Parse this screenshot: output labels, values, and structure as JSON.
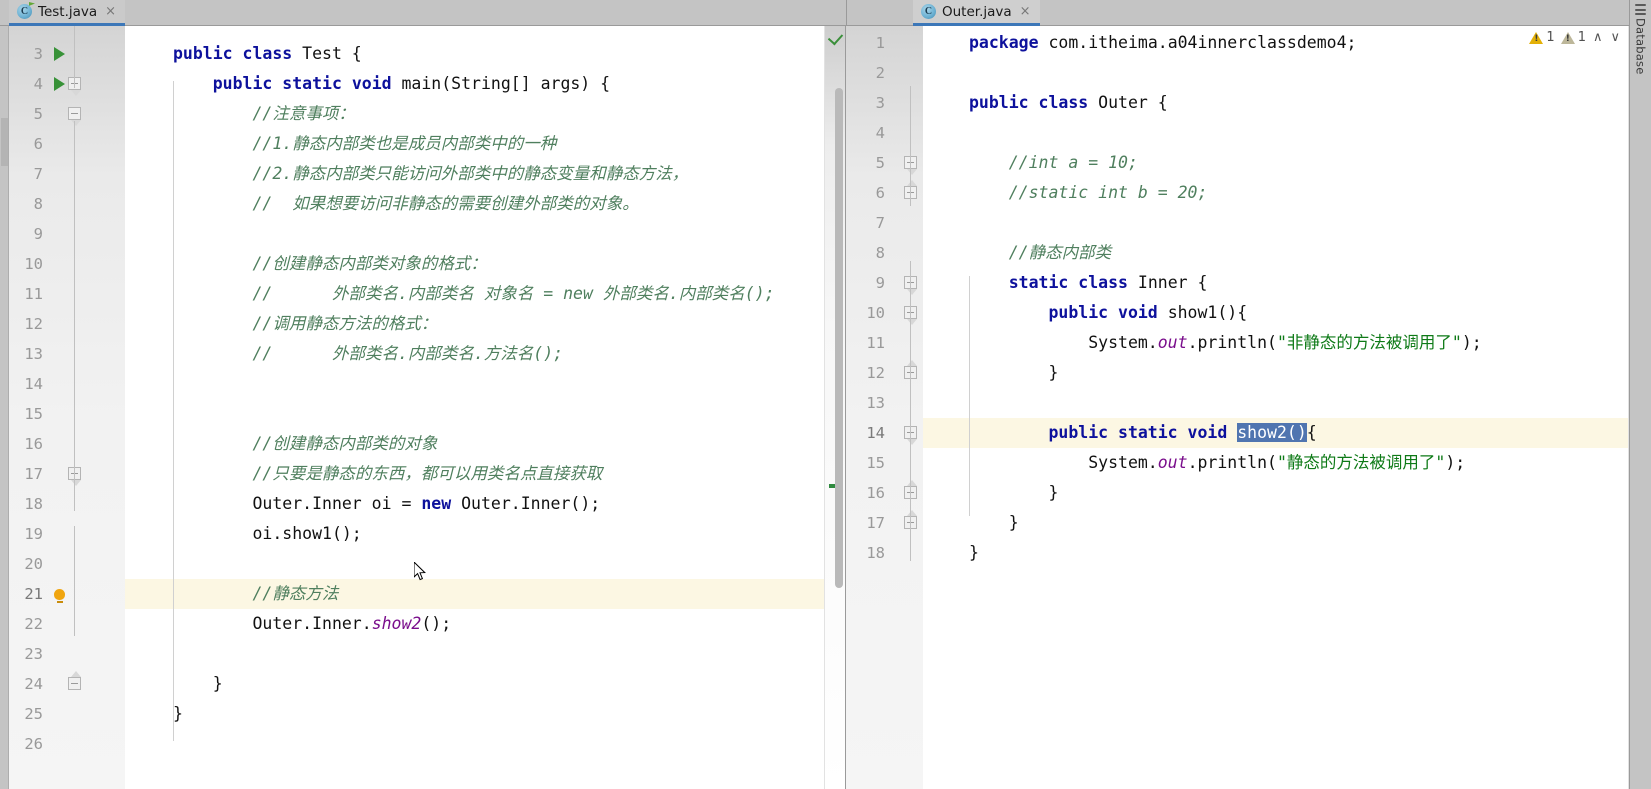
{
  "app": {
    "name": "IntelliJ IDEA Editor",
    "right_tool_label": "Database"
  },
  "tabs": {
    "left": {
      "label": "Test.java",
      "icon": "java-class-file-icon",
      "close": "×"
    },
    "right": {
      "label": "Outer.java",
      "icon": "java-class-file-icon",
      "close": "×"
    }
  },
  "inspection": {
    "warning_icon": "warning-triangle-icon",
    "warning_count": "1",
    "weak_icon": "weak-warning-triangle-icon",
    "weak_count": "1",
    "prev_icon": "chevron-up-icon",
    "next_icon": "chevron-down-icon",
    "prev_glyph": "∧",
    "next_glyph": "∨",
    "status_ok_icon": "analysis-ok-checkmark-icon"
  },
  "editors": {
    "test_java": {
      "file": "Test.java",
      "first_visible_line": 3,
      "current_line": 21,
      "lines": [
        {
          "n": 3,
          "gutter": "run",
          "fold": null,
          "tokens": [
            {
              "t": "kw",
              "v": "public class "
            },
            {
              "t": "plain",
              "v": "Test {"
            }
          ]
        },
        {
          "n": 4,
          "gutter": "run",
          "fold": "down",
          "tokens": [
            {
              "t": "plain",
              "v": "    "
            },
            {
              "t": "kw",
              "v": "public static void "
            },
            {
              "t": "plain",
              "v": "main(String[] args) {"
            }
          ]
        },
        {
          "n": 5,
          "gutter": null,
          "fold": "down",
          "tokens": [
            {
              "t": "cm",
              "v": "        //注意事项："
            }
          ]
        },
        {
          "n": 6,
          "gutter": null,
          "fold": null,
          "tokens": [
            {
              "t": "cm",
              "v": "        //1.静态内部类也是成员内部类中的一种"
            }
          ]
        },
        {
          "n": 7,
          "gutter": null,
          "fold": null,
          "tokens": [
            {
              "t": "cm",
              "v": "        //2.静态内部类只能访问外部类中的静态变量和静态方法，"
            }
          ]
        },
        {
          "n": 8,
          "gutter": null,
          "fold": null,
          "tokens": [
            {
              "t": "cm",
              "v": "        //  如果想要访问非静态的需要创建外部类的对象。"
            }
          ]
        },
        {
          "n": 9,
          "gutter": null,
          "fold": null,
          "tokens": []
        },
        {
          "n": 10,
          "gutter": null,
          "fold": null,
          "tokens": [
            {
              "t": "cm",
              "v": "        //创建静态内部类对象的格式："
            }
          ]
        },
        {
          "n": 11,
          "gutter": null,
          "fold": null,
          "tokens": [
            {
              "t": "cm",
              "v": "        //      外部类名.内部类名 对象名 = new 外部类名.内部类名();"
            }
          ]
        },
        {
          "n": 12,
          "gutter": null,
          "fold": null,
          "tokens": [
            {
              "t": "cm",
              "v": "        //调用静态方法的格式："
            }
          ]
        },
        {
          "n": 13,
          "gutter": null,
          "fold": null,
          "tokens": [
            {
              "t": "cm",
              "v": "        //      外部类名.内部类名.方法名();"
            }
          ]
        },
        {
          "n": 14,
          "gutter": null,
          "fold": null,
          "tokens": []
        },
        {
          "n": 15,
          "gutter": null,
          "fold": null,
          "tokens": []
        },
        {
          "n": 16,
          "gutter": null,
          "fold": null,
          "tokens": [
            {
              "t": "cm",
              "v": "        //创建静态内部类的对象"
            }
          ]
        },
        {
          "n": 17,
          "gutter": null,
          "fold": "down",
          "tokens": [
            {
              "t": "cm",
              "v": "        //只要是静态的东西，都可以用类名点直接获取"
            }
          ]
        },
        {
          "n": 18,
          "gutter": null,
          "fold": null,
          "tokens": [
            {
              "t": "plain",
              "v": "        Outer.Inner oi = "
            },
            {
              "t": "kw",
              "v": "new "
            },
            {
              "t": "plain",
              "v": "Outer.Inner();"
            }
          ]
        },
        {
          "n": 19,
          "gutter": null,
          "fold": null,
          "tokens": [
            {
              "t": "plain",
              "v": "        oi.show1();"
            }
          ]
        },
        {
          "n": 20,
          "gutter": null,
          "fold": null,
          "tokens": []
        },
        {
          "n": 21,
          "gutter": "bulb",
          "fold": null,
          "highlight": true,
          "tokens": [
            {
              "t": "cm",
              "v": "        //静态方法"
            }
          ]
        },
        {
          "n": 22,
          "gutter": null,
          "fold": null,
          "tokens": [
            {
              "t": "plain",
              "v": "        Outer.Inner."
            },
            {
              "t": "fld",
              "v": "show2"
            },
            {
              "t": "plain",
              "v": "();"
            }
          ]
        },
        {
          "n": 23,
          "gutter": null,
          "fold": null,
          "tokens": []
        },
        {
          "n": 24,
          "gutter": null,
          "fold": "up",
          "tokens": [
            {
              "t": "plain",
              "v": "    }"
            }
          ]
        },
        {
          "n": 25,
          "gutter": null,
          "fold": null,
          "tokens": [
            {
              "t": "plain",
              "v": "}"
            }
          ]
        },
        {
          "n": 26,
          "gutter": null,
          "fold": null,
          "tokens": []
        }
      ]
    },
    "outer_java": {
      "file": "Outer.java",
      "first_visible_line": 1,
      "current_line": 14,
      "selection_text": "show2()",
      "lines": [
        {
          "n": 1,
          "fold": null,
          "tokens": [
            {
              "t": "kw",
              "v": "package "
            },
            {
              "t": "plain",
              "v": "com.itheima.a04innerclassdemo4;"
            }
          ]
        },
        {
          "n": 2,
          "fold": null,
          "tokens": []
        },
        {
          "n": 3,
          "fold": null,
          "tokens": [
            {
              "t": "kw",
              "v": "public class "
            },
            {
              "t": "plain",
              "v": "Outer {"
            }
          ]
        },
        {
          "n": 4,
          "fold": null,
          "tokens": []
        },
        {
          "n": 5,
          "fold": "down",
          "tokens": [
            {
              "t": "cm",
              "v": "    //int a = 10;"
            }
          ]
        },
        {
          "n": 6,
          "fold": "up",
          "tokens": [
            {
              "t": "cm",
              "v": "    //static int b = 20;"
            }
          ]
        },
        {
          "n": 7,
          "fold": null,
          "tokens": []
        },
        {
          "n": 8,
          "fold": null,
          "tokens": [
            {
              "t": "cm",
              "v": "    //静态内部类"
            }
          ]
        },
        {
          "n": 9,
          "fold": "down",
          "tokens": [
            {
              "t": "kw",
              "v": "    static class "
            },
            {
              "t": "plain",
              "v": "Inner {"
            }
          ]
        },
        {
          "n": 10,
          "fold": "down",
          "tokens": [
            {
              "t": "kw",
              "v": "        public void "
            },
            {
              "t": "plain",
              "v": "show1(){"
            }
          ]
        },
        {
          "n": 11,
          "fold": null,
          "tokens": [
            {
              "t": "plain",
              "v": "            System."
            },
            {
              "t": "fld",
              "v": "out"
            },
            {
              "t": "plain",
              "v": ".println("
            },
            {
              "t": "str",
              "v": "\"非静态的方法被调用了\""
            },
            {
              "t": "plain",
              "v": ");"
            }
          ]
        },
        {
          "n": 12,
          "fold": "up",
          "tokens": [
            {
              "t": "plain",
              "v": "        }"
            }
          ]
        },
        {
          "n": 13,
          "fold": null,
          "tokens": []
        },
        {
          "n": 14,
          "fold": "down",
          "highlight": true,
          "tokens": [
            {
              "t": "kw",
              "v": "        public static void "
            },
            {
              "t": "sel",
              "v": "show2()"
            },
            {
              "t": "plain",
              "v": "{"
            }
          ]
        },
        {
          "n": 15,
          "fold": null,
          "tokens": [
            {
              "t": "plain",
              "v": "            System."
            },
            {
              "t": "fld",
              "v": "out"
            },
            {
              "t": "plain",
              "v": ".println("
            },
            {
              "t": "str",
              "v": "\"静态的方法被调用了\""
            },
            {
              "t": "plain",
              "v": ");"
            }
          ]
        },
        {
          "n": 16,
          "fold": "up",
          "tokens": [
            {
              "t": "plain",
              "v": "        }"
            }
          ]
        },
        {
          "n": 17,
          "fold": "up",
          "tokens": [
            {
              "t": "plain",
              "v": "    }"
            }
          ]
        },
        {
          "n": 18,
          "fold": null,
          "tokens": [
            {
              "t": "plain",
              "v": "}"
            }
          ]
        }
      ]
    }
  },
  "colors": {
    "keyword": "#0d119c",
    "comment": "#4f7f5e",
    "string": "#0e7a17",
    "field": "#7a0e8c",
    "selection": "#5075b0",
    "current_line": "#fcf7e3",
    "tab_underline": "#3c77b8",
    "warning": "#e3b006"
  }
}
